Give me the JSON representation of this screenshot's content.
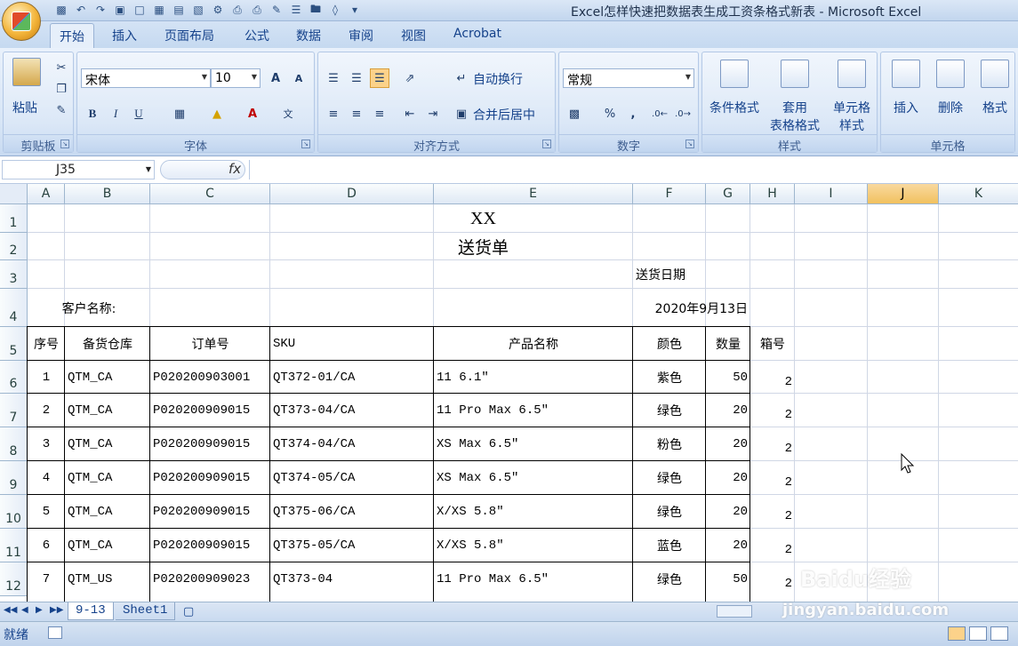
{
  "window": {
    "title": "Excel怎样快速把数据表生成工资条格式新表 - Microsoft Excel"
  },
  "tabs": [
    "开始",
    "插入",
    "页面布局",
    "公式",
    "数据",
    "审阅",
    "视图",
    "Acrobat"
  ],
  "ribbon": {
    "clipboard": {
      "paste": "粘贴",
      "label": "剪贴板"
    },
    "font": {
      "name": "宋体",
      "size": "10",
      "label": "字体",
      "bold": "B",
      "italic": "I",
      "underline": "U",
      "grow": "A",
      "shrink": "A"
    },
    "align": {
      "wrap": "自动换行",
      "merge": "合并后居中",
      "label": "对齐方式"
    },
    "number": {
      "format": "常规",
      "percent": "%",
      "comma": ",",
      "label": "数字"
    },
    "styles": {
      "cond": "条件格式",
      "table1": "套用",
      "table2": "表格格式",
      "cell1": "单元格",
      "cell2": "样式",
      "label": "样式"
    },
    "cells": {
      "insert": "插入",
      "delete": "删除",
      "format": "格式",
      "label": "单元格"
    }
  },
  "formula_bar": {
    "name_box": "J35",
    "fx": "fx",
    "value": ""
  },
  "columns": [
    "A",
    "B",
    "C",
    "D",
    "E",
    "F",
    "G",
    "H",
    "I",
    "J",
    "K"
  ],
  "selected_column": "J",
  "rows": [
    "1",
    "2",
    "3",
    "4",
    "5",
    "6",
    "7",
    "8",
    "9",
    "10",
    "11",
    "12"
  ],
  "sheet": {
    "title": "XX",
    "subtitle": "送货单",
    "date_label": "送货日期",
    "date_value": "2020年9月13日",
    "customer_label": "客户名称:",
    "headers": [
      "序号",
      "备货仓库",
      "订单号",
      "SKU",
      "产品名称",
      "颜色",
      "数量",
      "箱号"
    ],
    "data": [
      [
        "1",
        "QTM_CA",
        "P020200903001",
        "QT372-01/CA",
        "11 6.1″",
        "紫色",
        "50",
        "2"
      ],
      [
        "2",
        "QTM_CA",
        "P020200909015",
        "QT373-04/CA",
        "11 Pro Max 6.5″",
        "绿色",
        "20",
        "2"
      ],
      [
        "3",
        "QTM_CA",
        "P020200909015",
        "QT374-04/CA",
        "XS Max 6.5″",
        "粉色",
        "20",
        "2"
      ],
      [
        "4",
        "QTM_CA",
        "P020200909015",
        "QT374-05/CA",
        "XS Max 6.5″",
        "绿色",
        "20",
        "2"
      ],
      [
        "5",
        "QTM_CA",
        "P020200909015",
        "QT375-06/CA",
        "X/XS 5.8″",
        "绿色",
        "20",
        "2"
      ],
      [
        "6",
        "QTM_CA",
        "P020200909015",
        "QT375-05/CA",
        "X/XS 5.8″",
        "蓝色",
        "20",
        "2"
      ],
      [
        "7",
        "QTM_US",
        "P020200909023",
        "QT373-04",
        "11 Pro Max 6.5″",
        "绿色",
        "50",
        "2"
      ]
    ]
  },
  "sheet_tabs": [
    "9-13",
    "Sheet1"
  ],
  "status": {
    "ready": "就绪"
  },
  "watermark": {
    "brand": "Baidu经验",
    "url": "jingyan.baidu.com"
  }
}
